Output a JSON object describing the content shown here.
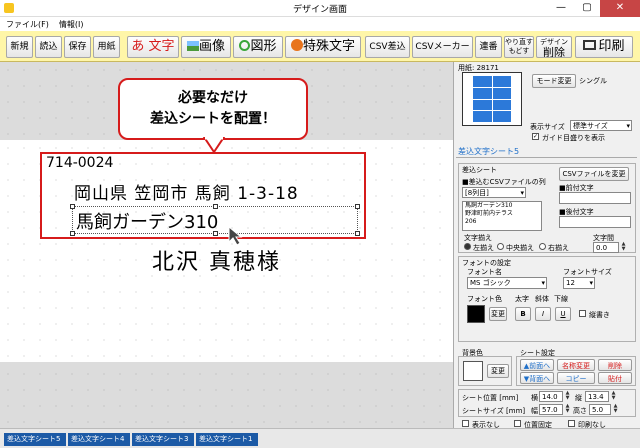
{
  "window": {
    "title": "デザイン画面",
    "minimize": "—",
    "maximize": "▢",
    "close": "✕"
  },
  "menu": {
    "file": "ファイル(F)",
    "info": "情報(I)"
  },
  "toolbar": {
    "new": "新規",
    "load": "読込",
    "save": "保存",
    "paper": "用紙",
    "text": "あ 文字",
    "image": "画像",
    "shape": "図形",
    "special": "特殊文字",
    "csv": "CSV差込",
    "csvmaker": "CSVメーカー",
    "serial": "連番",
    "redo1": "やり直す",
    "redo2": "もどす",
    "delete_top": "デザイン",
    "delete": "削除",
    "print": "印刷"
  },
  "canvas": {
    "callout_line1": "必要なだけ",
    "callout_line2": "差込シートを配置！",
    "postal": "714-0024",
    "address1": "岡山県 笠岡市 馬飼 1-3-18",
    "address2": "馬飼ガーデン310",
    "name": "北沢 真穂様"
  },
  "panel": {
    "paper_label": "用紙: 28171",
    "mode_button": "モード変更",
    "mode_value": "シングル",
    "display_size_label": "表示サイズ",
    "display_size_value": "標準サイズ",
    "guide_label": "ガイド目盛りを表示",
    "sheet_title": "差込文字シート5",
    "sheet_group": "差込シート",
    "csv_button": "CSVファイルを変更",
    "csv_col_label": "■差込むCSVファイルの列",
    "col_value": "[8列目]",
    "prefix_label": "■前付文字",
    "suffix_label": "■後付文字",
    "preview_text1": "馬飼ガーデン310",
    "preview_text2": "野津町前内テラス",
    "preview_text3": "206",
    "align_label": "文字揃え",
    "left_align": "左揃え",
    "center_align": "中央揃え",
    "right_align": "右揃え",
    "spacing_label": "文字間",
    "spacing_value": "0.0",
    "font_group": "フォントの設定",
    "font_name_label": "フォント名",
    "font_name_value": "MS ゴシック",
    "font_size_label": "フォントサイズ",
    "font_size_value": "12",
    "font_color_label": "フォント色",
    "bold_label": "太字",
    "italic_label": "斜体",
    "underline_label": "下線",
    "change_button": "変更",
    "bold": "B",
    "italic": "I",
    "underline": "U",
    "vertical_label": "縦書き",
    "bg_label": "背景色",
    "bg_change": "変更",
    "sheet_settings": "シート設定",
    "front_button": "▲前面へ",
    "back_button": "▼背面へ",
    "name_change": "名称変更",
    "copy_button": "コピー",
    "delete_button": "削除",
    "paste_button": "貼付",
    "pos_label": "シート位置 [mm]",
    "pos_x_label": "横",
    "pos_x": "14.0",
    "pos_y_label": "縦",
    "pos_y": "13.4",
    "size_label": "シートサイズ [mm]",
    "width_label": "幅",
    "width": "57.0",
    "height_label": "高さ",
    "height": "5.0",
    "hide_label": "表示なし",
    "lock_label": "位置固定",
    "noprint_label": "印刷なし"
  },
  "taskbar": {
    "tab1": "差込文字シート5",
    "tab2": "差込文字シート4",
    "tab3": "差込文字シート3",
    "tab4": "差込文字シート1"
  },
  "colors": {
    "accent": "#d61b1b",
    "toolbar_bg": "#fff6a8",
    "tab_blue": "#1c5aa6",
    "label_blue": "#1f6fc9",
    "font_color": "#000000"
  }
}
